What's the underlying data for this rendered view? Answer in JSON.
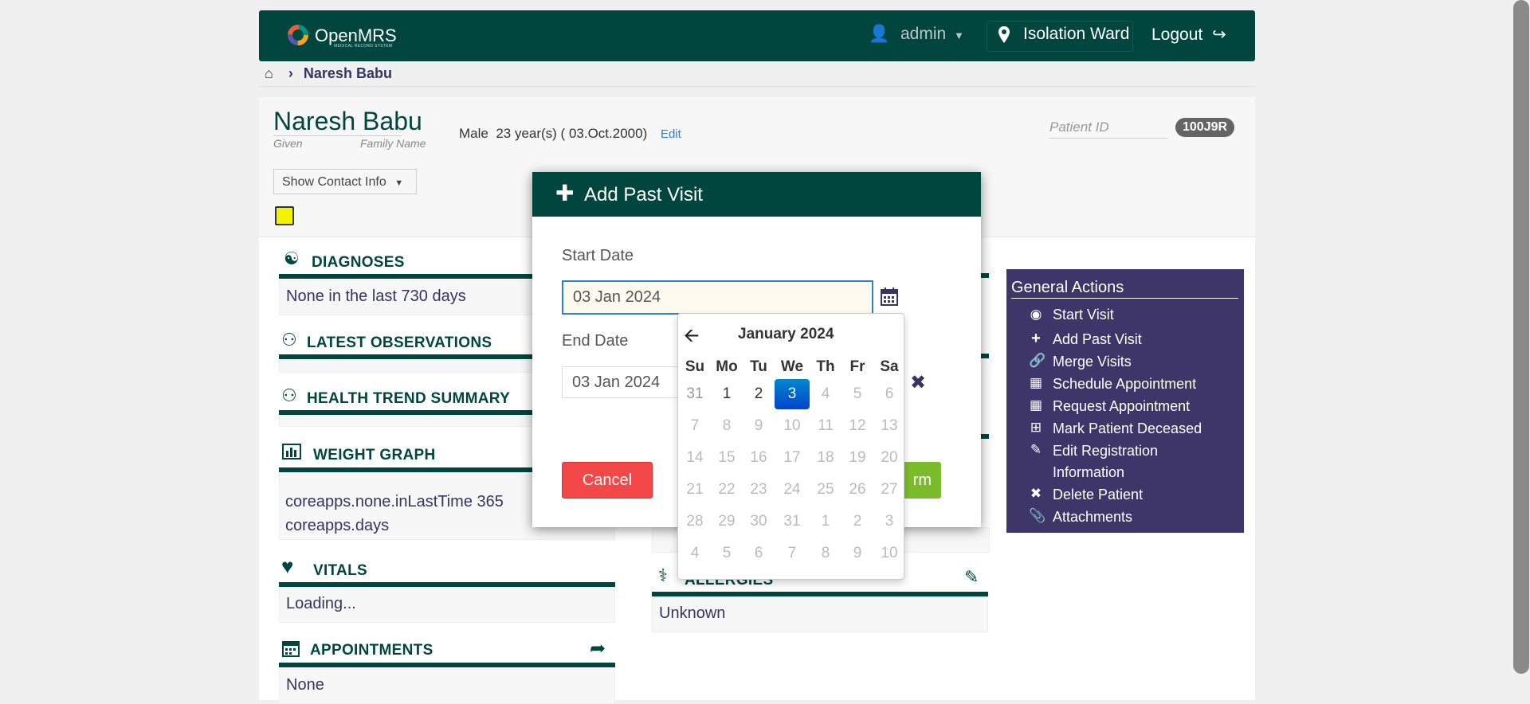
{
  "header": {
    "logo_text": "OpenMRS",
    "logo_sub": "MEDICAL RECORD SYSTEM",
    "user": "admin",
    "location": "Isolation Ward",
    "logout": "Logout"
  },
  "breadcrumb": {
    "patient": "Naresh Babu"
  },
  "patient": {
    "name": "Naresh Babu",
    "given_label": "Given",
    "family_label": "Family Name",
    "gender": "Male",
    "age": "23 year(s) ( 03.Oct.2000)",
    "edit": "Edit",
    "id_label": "Patient ID",
    "id": "100J9R",
    "contact_button": "Show Contact Info"
  },
  "sections": {
    "diagnoses": {
      "title": "DIAGNOSES",
      "body": "None in the last 730 days"
    },
    "latest_obs": {
      "title": "LATEST OBSERVATIONS"
    },
    "health_trend": {
      "title": "HEALTH TREND SUMMARY"
    },
    "weight_graph": {
      "title": "WEIGHT GRAPH",
      "body1": "coreapps.none.inLastTime 365",
      "body2": "coreapps.days"
    },
    "vitals": {
      "title": "VITALS",
      "body": "Loading..."
    },
    "appointments": {
      "title": "APPOINTMENTS",
      "body": "None"
    },
    "allergies": {
      "title": "ALLERGIES",
      "body": "Unknown"
    }
  },
  "general_actions": {
    "title": "General Actions",
    "items": [
      {
        "label": "Start Visit",
        "icon": "location-pin-icon"
      },
      {
        "label": "Add Past Visit",
        "icon": "plus-icon"
      },
      {
        "label": "Merge Visits",
        "icon": "link-icon"
      },
      {
        "label": "Schedule Appointment",
        "icon": "calendar-icon"
      },
      {
        "label": "Request Appointment",
        "icon": "calendar-icon"
      },
      {
        "label": "Mark Patient Deceased",
        "icon": "plus-square-icon"
      },
      {
        "label": "Edit Registration",
        "icon": "pencil-icon"
      },
      {
        "label": "Information",
        "icon": ""
      },
      {
        "label": "Delete Patient",
        "icon": "close-icon"
      },
      {
        "label": "Attachments",
        "icon": "paperclip-icon"
      }
    ]
  },
  "modal": {
    "title": "Add Past Visit",
    "start_label": "Start Date",
    "start_value": "03 Jan 2024",
    "end_label": "End Date",
    "end_value": "03 Jan 2024",
    "cancel": "Cancel",
    "confirm_partial": "rm"
  },
  "datepicker": {
    "title": "January 2024",
    "weekdays": [
      "Su",
      "Mo",
      "Tu",
      "We",
      "Th",
      "Fr",
      "Sa"
    ],
    "weeks": [
      [
        "31",
        "1",
        "2",
        "3",
        "4",
        "5",
        "6"
      ],
      [
        "7",
        "8",
        "9",
        "10",
        "11",
        "12",
        "13"
      ],
      [
        "14",
        "15",
        "16",
        "17",
        "18",
        "19",
        "20"
      ],
      [
        "21",
        "22",
        "23",
        "24",
        "25",
        "26",
        "27"
      ],
      [
        "28",
        "29",
        "30",
        "31",
        "1",
        "2",
        "3"
      ],
      [
        "4",
        "5",
        "6",
        "7",
        "8",
        "9",
        "10"
      ]
    ],
    "selected": "3"
  },
  "colors": {
    "brand": "#00463f",
    "actions_bg": "#3e3569",
    "cancel": "#f44747",
    "confirm": "#7bbc2c",
    "selected_day": "#0066cc"
  }
}
